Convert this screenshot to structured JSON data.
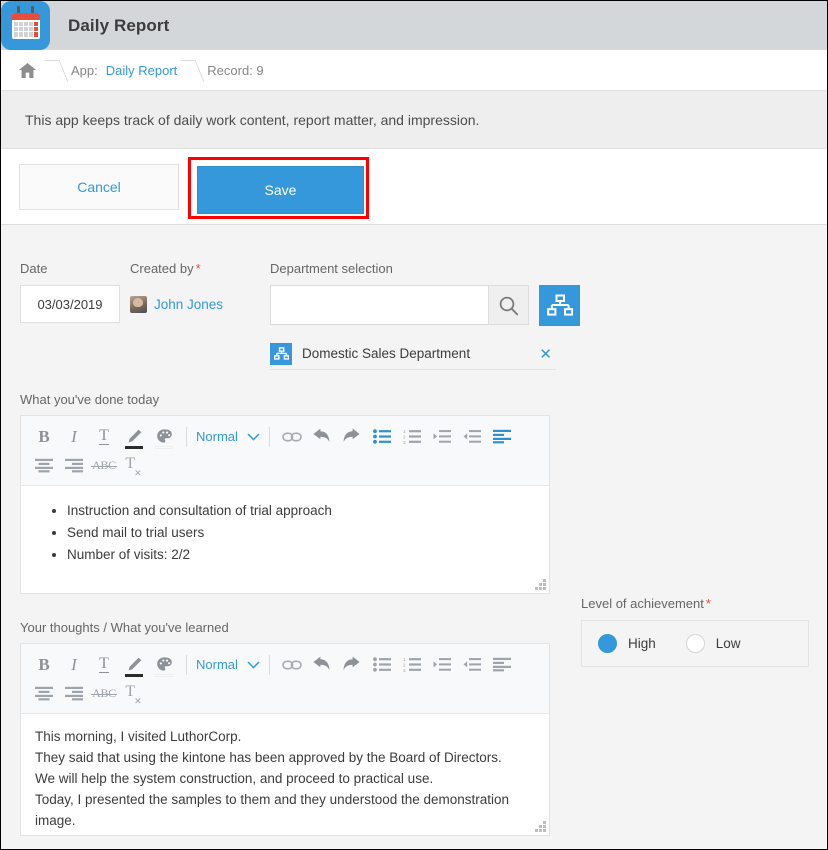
{
  "header": {
    "app_icon": "calendar-icon",
    "title": "Daily Report"
  },
  "breadcrumb": {
    "home_icon": "home-icon",
    "app_prefix": "App:",
    "app_name": "Daily Report",
    "record": "Record: 9"
  },
  "description": "This app keeps track of daily work content, report matter, and impression.",
  "actions": {
    "cancel_label": "Cancel",
    "save_label": "Save",
    "highlight_color": "#ff0000",
    "save_color": "#3498db"
  },
  "form": {
    "date": {
      "label": "Date",
      "value": "03/03/2019"
    },
    "created_by": {
      "label": "Created by",
      "required": "*",
      "user_name": "John Jones",
      "avatar_icon": "user-avatar"
    },
    "department": {
      "label": "Department selection",
      "search_value": "",
      "search_placeholder": "",
      "search_icon": "search-icon",
      "org_chart_icon": "org-chart-icon",
      "selected": {
        "icon": "org-chart-icon",
        "name": "Domestic Sales Department",
        "remove_icon": "close-icon"
      }
    },
    "done_today": {
      "label": "What you've done today",
      "items": [
        "Instruction and consultation of trial approach",
        "Send mail to trial users",
        "Number of visits: 2/2"
      ]
    },
    "thoughts": {
      "label": "Your thoughts / What you've learned",
      "lines": [
        "This morning, I visited LuthorCorp.",
        "They said that using the kintone has been approved by the Board of Directors.",
        "We will help the system construction, and proceed to practical use.",
        "Today, I presented the samples to them and they understood the demonstration",
        "image."
      ]
    },
    "achievement": {
      "label": "Level of achievement",
      "required": "*",
      "options": [
        {
          "label": "High",
          "selected": true
        },
        {
          "label": "Low",
          "selected": false
        }
      ]
    }
  },
  "toolbar": {
    "style_label": "Normal",
    "bold": "B",
    "italic": "I",
    "underline": "T",
    "strikethrough": "ABC",
    "clear_format": "T",
    "icons": [
      "bold-icon",
      "italic-icon",
      "underline-icon",
      "text-color-pen-icon",
      "background-color-palette-icon",
      "style-dropdown",
      "link-icon",
      "undo-icon",
      "redo-icon",
      "bullet-list-icon",
      "numbered-list-icon",
      "indent-icon",
      "outdent-icon",
      "align-left-icon",
      "align-center-icon",
      "align-right-icon",
      "strikethrough-icon",
      "clear-format-icon"
    ],
    "active_color": "#2e8fd4"
  }
}
